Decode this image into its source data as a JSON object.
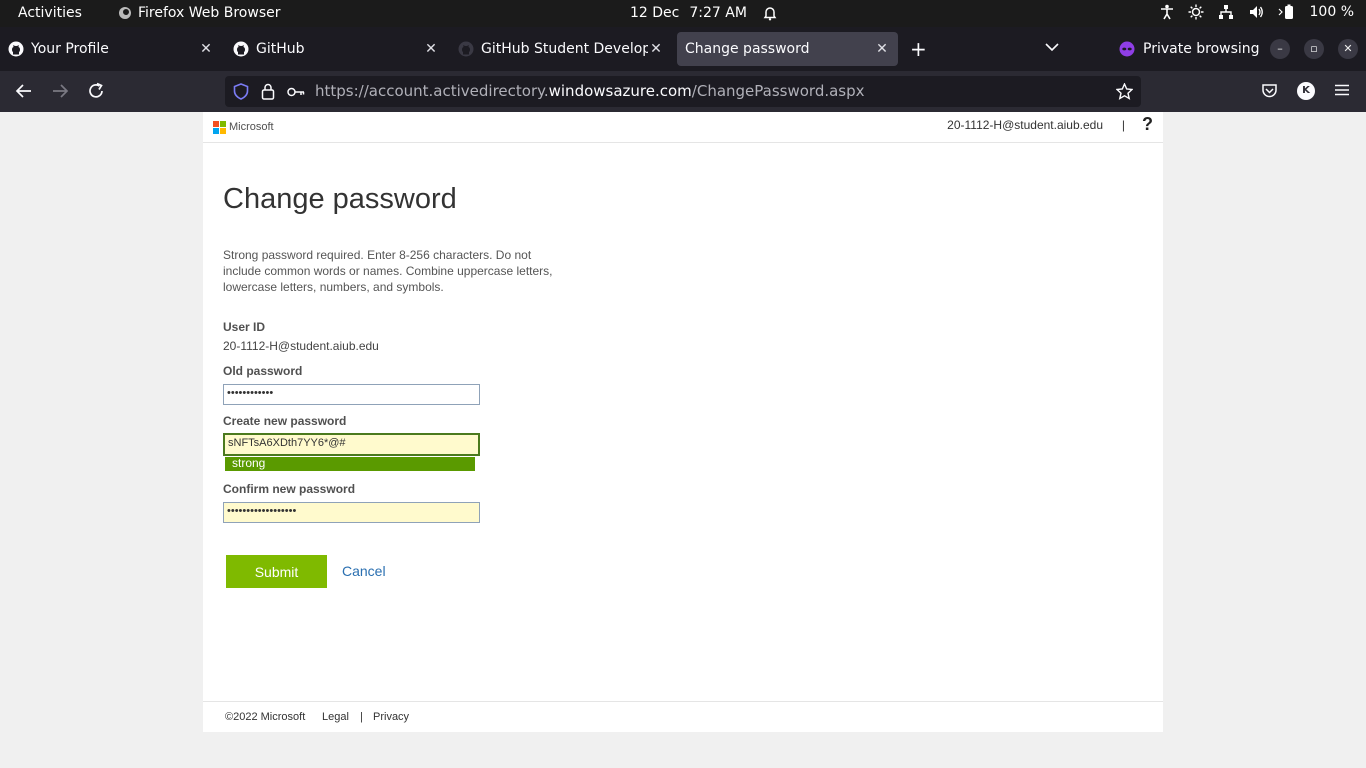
{
  "system_bar": {
    "activities": "Activities",
    "app_name": "Firefox Web Browser",
    "date": "12 Dec",
    "time": "7:27 AM",
    "battery": "100 %"
  },
  "tabs": [
    {
      "title": "Your Profile",
      "icon": "github-icon"
    },
    {
      "title": "GitHub",
      "icon": "github-icon"
    },
    {
      "title": "GitHub Student Develope",
      "icon": "github-icon"
    },
    {
      "title": "Change password",
      "icon": "none",
      "active": true
    }
  ],
  "private_label": "Private browsing",
  "url": {
    "prefix": "https://account.activedirectory.",
    "domain": "windowsazure.com",
    "path": "/ChangePassword.aspx"
  },
  "account_initial": "K",
  "header": {
    "brand": "Microsoft",
    "user": "20-1112-H@student.aiub.edu",
    "separator": "|",
    "help": "?"
  },
  "form": {
    "title": "Change password",
    "intro": "Strong password required. Enter 8-256 characters. Do not include common words or names. Combine uppercase letters, lowercase letters, numbers, and symbols.",
    "user_id_label": "User ID",
    "user_id_value": "20-1112-H@student.aiub.edu",
    "old_password_label": "Old password",
    "old_password_value": "••••••••••••",
    "new_password_label": "Create new password",
    "new_password_value": "sNFTsA6XDth7YY6*@#",
    "strength": "strong",
    "confirm_password_label": "Confirm new password",
    "confirm_password_value": "••••••••••••••••••",
    "submit_label": "Submit",
    "cancel_label": "Cancel"
  },
  "footer": {
    "copyright": "©2022 Microsoft",
    "legal": "Legal",
    "separator": "|",
    "privacy": "Privacy"
  },
  "colors": {
    "submit": "#7fba00",
    "strength_bar": "#5a9a00",
    "link": "#2a6fb0",
    "autofill": "#fffacd"
  }
}
